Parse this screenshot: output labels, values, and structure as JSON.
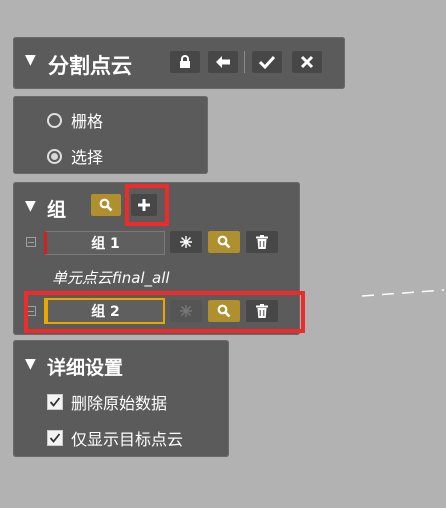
{
  "header": {
    "title": "分割点云",
    "collapse_glyph": "▼"
  },
  "mode": {
    "options": [
      {
        "label": "栅格",
        "selected": false
      },
      {
        "label": "选择",
        "selected": true
      }
    ]
  },
  "groups": {
    "title": "组",
    "collapse_glyph": "▼",
    "items": [
      {
        "name": "组 1",
        "subtitle": "单元点云final_all",
        "color": "#d02020"
      },
      {
        "name": "组 2",
        "subtitle": "",
        "color": "#e8a800"
      }
    ]
  },
  "details": {
    "title": "详细设置",
    "collapse_glyph": "▼",
    "checkboxes": [
      {
        "label": "删除原始数据",
        "checked": true
      },
      {
        "label": "仅显示目标点云",
        "checked": true
      }
    ]
  },
  "colors": {
    "accent_gold": "#b08f2e",
    "highlight_red": "#ee2a2a",
    "panel_bg": "#5b5b5b",
    "canvas_bg": "#b2b2b2"
  },
  "icons": [
    "pin-icon",
    "lock-icon",
    "back-arrow-icon",
    "check-icon",
    "close-icon",
    "search-icon",
    "plus-icon",
    "sparkle-icon",
    "trash-icon",
    "collapse-box-icon"
  ]
}
